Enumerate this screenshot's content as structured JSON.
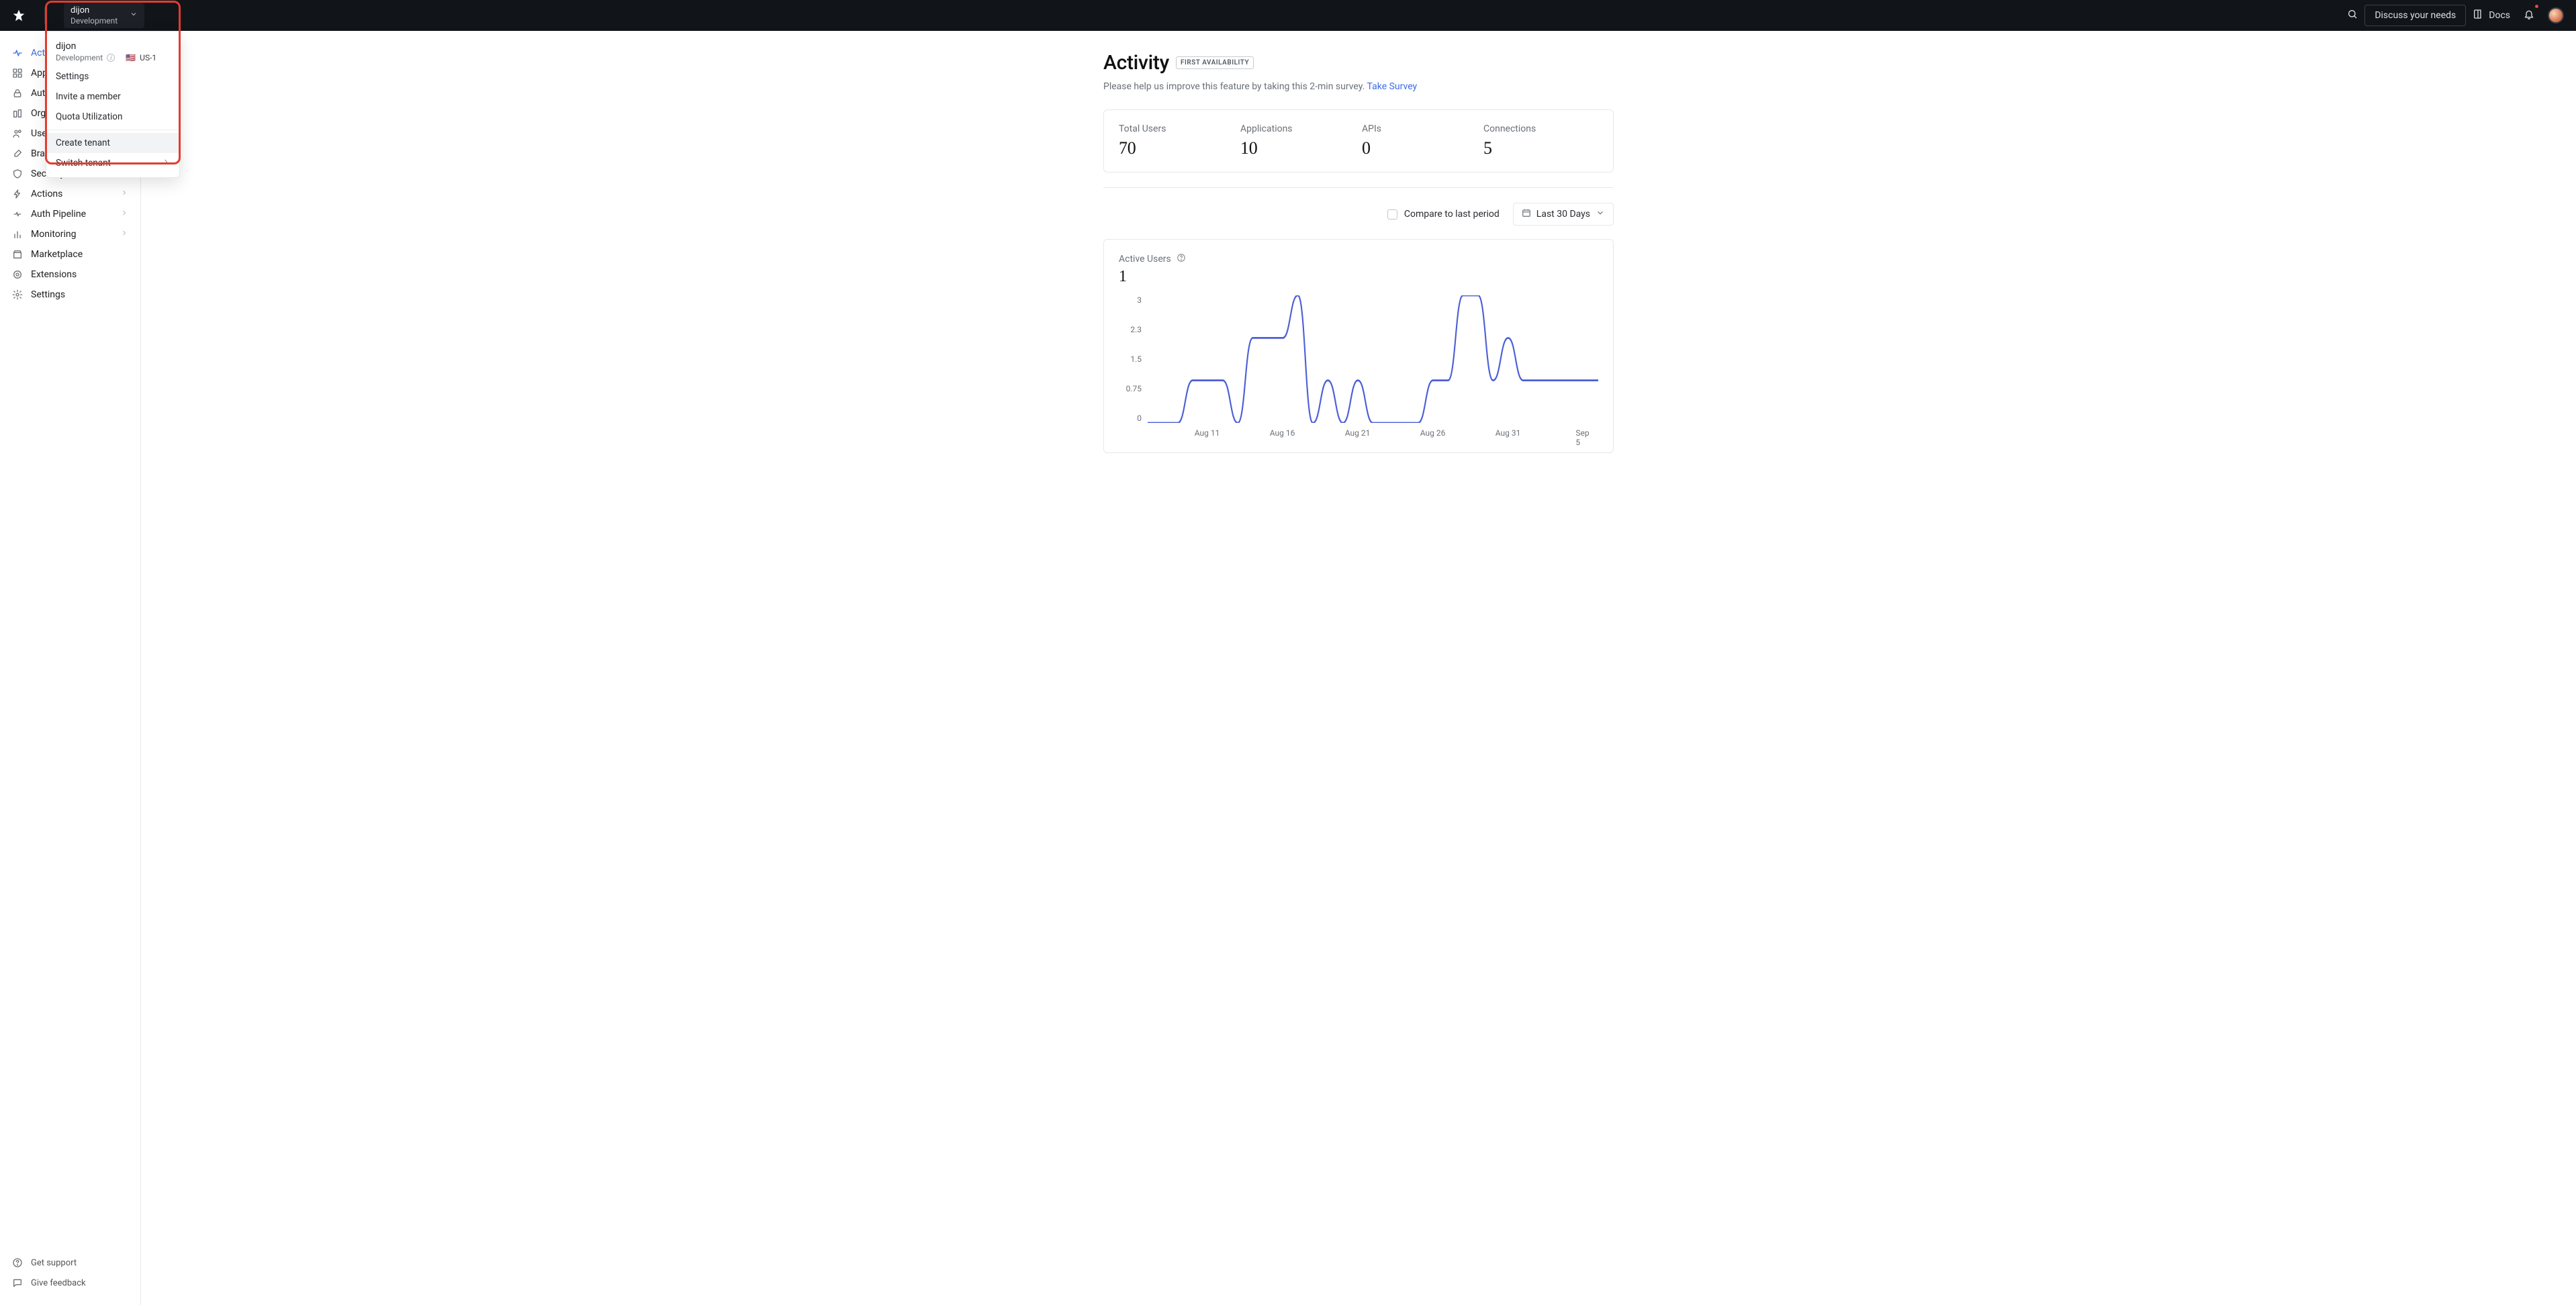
{
  "topbar": {
    "tenant": {
      "name": "dijon",
      "env": "Development"
    },
    "discuss": "Discuss your needs",
    "docs": "Docs"
  },
  "dropdown": {
    "tenant_name": "dijon",
    "env": "Development",
    "region": "US-1",
    "flag": "🇺🇸",
    "items_top": [
      "Settings",
      "Invite a member",
      "Quota Utilization"
    ],
    "items_bottom": [
      {
        "label": "Create tenant",
        "hover": true,
        "submenu": false
      },
      {
        "label": "Switch tenant",
        "hover": false,
        "submenu": true
      }
    ]
  },
  "sidebar": {
    "items": [
      {
        "label": "Activity",
        "active": true,
        "expandable": false,
        "icon": "activity"
      },
      {
        "label": "Applications",
        "expandable": true,
        "icon": "apps"
      },
      {
        "label": "Authentication",
        "expandable": true,
        "icon": "lock"
      },
      {
        "label": "Organizations",
        "expandable": false,
        "icon": "org"
      },
      {
        "label": "User Management",
        "expandable": true,
        "icon": "users"
      },
      {
        "label": "Branding",
        "expandable": true,
        "icon": "brush"
      },
      {
        "label": "Security",
        "expandable": true,
        "icon": "shield"
      },
      {
        "label": "Actions",
        "expandable": true,
        "icon": "bolt"
      },
      {
        "label": "Auth Pipeline",
        "expandable": true,
        "icon": "pipeline"
      },
      {
        "label": "Monitoring",
        "expandable": true,
        "icon": "bars"
      },
      {
        "label": "Marketplace",
        "expandable": false,
        "icon": "market"
      },
      {
        "label": "Extensions",
        "expandable": false,
        "icon": "ext"
      },
      {
        "label": "Settings",
        "expandable": false,
        "icon": "gear"
      }
    ],
    "footer": [
      {
        "label": "Get support",
        "icon": "help"
      },
      {
        "label": "Give feedback",
        "icon": "comment"
      }
    ]
  },
  "page": {
    "title": "Activity",
    "badge": "FIRST AVAILABILITY",
    "subtext": "Please help us improve this feature by taking this 2-min survey. ",
    "survey_link": "Take Survey",
    "stats": [
      {
        "label": "Total Users",
        "value": "70"
      },
      {
        "label": "Applications",
        "value": "10"
      },
      {
        "label": "APIs",
        "value": "0"
      },
      {
        "label": "Connections",
        "value": "5"
      }
    ],
    "compare": "Compare to last period",
    "range": "Last 30 Days",
    "chart_title": "Active Users",
    "chart_value": "1"
  },
  "chart_data": {
    "type": "line",
    "title": "Active Users",
    "xlabel": "",
    "ylabel": "",
    "ylim": [
      0,
      3
    ],
    "yticks": [
      0,
      0.75,
      1.5,
      2.3,
      3
    ],
    "xticks": [
      "Aug 11",
      "Aug 16",
      "Aug 21",
      "Aug 26",
      "Aug 31",
      "Sep 5"
    ],
    "x": [
      "Aug 7",
      "Aug 8",
      "Aug 9",
      "Aug 10",
      "Aug 11",
      "Aug 12",
      "Aug 13",
      "Aug 14",
      "Aug 15",
      "Aug 16",
      "Aug 17",
      "Aug 18",
      "Aug 19",
      "Aug 20",
      "Aug 21",
      "Aug 22",
      "Aug 23",
      "Aug 24",
      "Aug 25",
      "Aug 26",
      "Aug 27",
      "Aug 28",
      "Aug 29",
      "Aug 30",
      "Aug 31",
      "Sep 1",
      "Sep 2",
      "Sep 3",
      "Sep 4",
      "Sep 5",
      "Sep 6"
    ],
    "values": [
      0,
      0,
      0,
      1,
      1,
      1,
      0,
      2,
      2,
      2,
      3,
      0,
      1,
      0,
      1,
      0,
      0,
      0,
      0,
      1,
      1,
      3,
      3,
      1,
      2,
      1,
      1,
      1,
      1,
      1,
      1
    ],
    "color": "#4c5fd6"
  }
}
